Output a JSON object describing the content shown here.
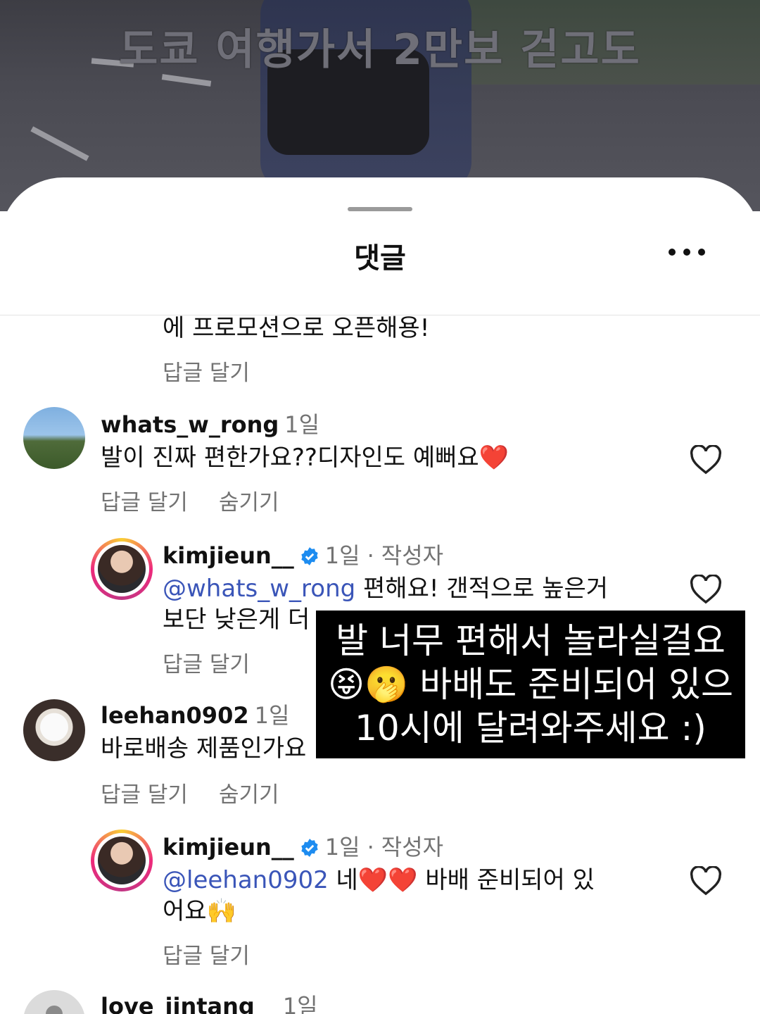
{
  "video": {
    "caption": "도쿄 여행가서 2만보 걷고도"
  },
  "sheet": {
    "title": "댓글"
  },
  "comments": {
    "partial_text": "에 프로모션으로 오픈해용!",
    "partial_reply": "답글 달기",
    "c1": {
      "username": "whats_w_rong",
      "time": "1일",
      "text": "발이 진짜 편한가요??디자인도 예뻐요",
      "emoji": "❤️",
      "reply": "답글 달기",
      "hide": "숨기기"
    },
    "r1": {
      "username": "kimjieun__",
      "time": "1일",
      "author": "작성자",
      "mention": "@whats_w_rong",
      "line1": " 편해요! 갠적으로 높은거",
      "line2": "보단 낮은게 더",
      "reply": "답글 달기"
    },
    "c2": {
      "username": "leehan0902",
      "time": "1일",
      "text": "바로배송 제품인가요",
      "reply": "답글 달기",
      "hide": "숨기기"
    },
    "r2": {
      "username": "kimjieun__",
      "time": "1일",
      "author": "작성자",
      "mention": "@leehan0902",
      "line1": " 네",
      "heart1": "❤️",
      "heart2": "❤️",
      "line1_tail": " 바배 준비되어 있",
      "line2": "어요",
      "emoji2": "🙌",
      "reply": "답글 달기"
    },
    "c3": {
      "username": "love_jintang__",
      "time": "1일"
    }
  },
  "overlay": {
    "line1": "발 너무 편해서 놀라실걸요",
    "line2_emoji": "😝🫢",
    "line2": " 바배도 준비되어 있으",
    "line3": "10시에 달려와주세요 :)"
  }
}
